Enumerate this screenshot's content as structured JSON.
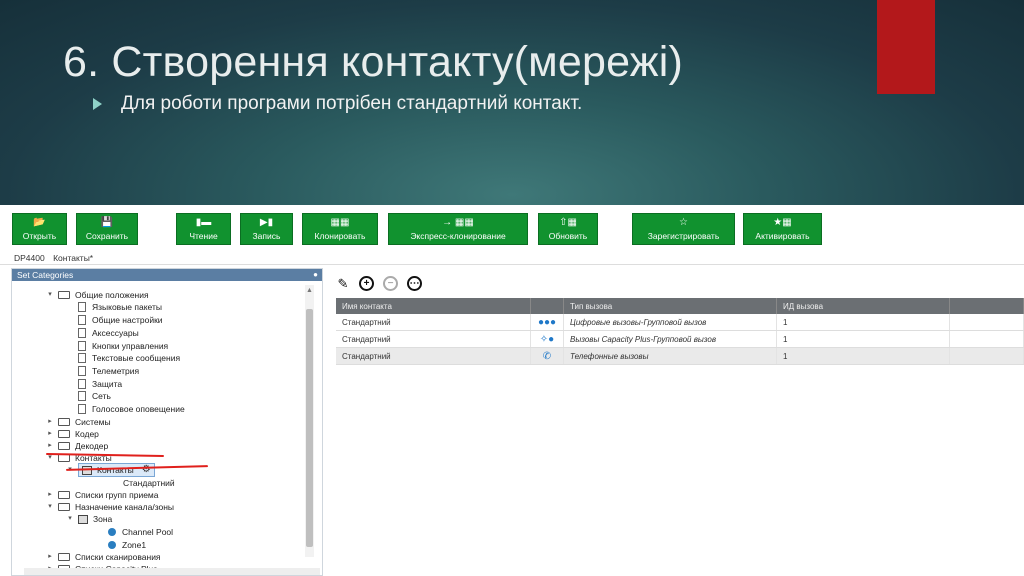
{
  "slide": {
    "title": "6. Створення контакту(мережі)",
    "bullet": "Для роботи програми потрібен стандартний контакт.",
    "accent_color": "#b3181b"
  },
  "toolbar": {
    "buttons": [
      {
        "label": "Открыть",
        "icon": "folder-open-icon"
      },
      {
        "label": "Сохранить",
        "icon": "save-icon"
      },
      {
        "label": "Чтение",
        "icon": "read-icon"
      },
      {
        "label": "Запись",
        "icon": "write-icon"
      },
      {
        "label": "Клонировать",
        "icon": "clone-icon"
      },
      {
        "label": "Экспресс-клонирование",
        "icon": "express-clone-icon"
      },
      {
        "label": "Обновить",
        "icon": "update-icon"
      },
      {
        "label": "Зарегистрировать",
        "icon": "star-icon"
      },
      {
        "label": "Активировать",
        "icon": "activate-icon"
      }
    ]
  },
  "breadcrumb": {
    "items": [
      "DP4400",
      "Контакты*"
    ]
  },
  "categories": {
    "header": "Set Categories",
    "tree": [
      "Общие положения",
      "Языковые пакеты",
      "Общие настройки",
      "Аксессуары",
      "Кнопки управления",
      "Текстовые сообщения",
      "Телеметрия",
      "Защита",
      "Сеть",
      "Голосовое оповещение",
      "Системы",
      "Кодер",
      "Декодер",
      "Контакты",
      "Контакты",
      "Стандартний",
      "Списки групп приема",
      "Назначение канала/зоны",
      "Зона",
      "Channel Pool",
      "Zone1",
      "Списки сканирования",
      "Списки Capacity Plus"
    ]
  },
  "contacts_grid": {
    "columns": [
      "Имя контакта",
      "",
      "Тип вызова",
      "ИД вызова"
    ],
    "rows": [
      {
        "name": "Стандартний",
        "icon": "digital-group-icon",
        "type": "Цифровые вызовы-Групповой вызов",
        "id": "1"
      },
      {
        "name": "Стандартний",
        "icon": "capacity-plus-icon",
        "type": "Вызовы Capacity Plus-Групповой вызов",
        "id": "1"
      },
      {
        "name": "Стандартний",
        "icon": "phone-icon",
        "type": "Телефонные вызовы",
        "id": "1"
      }
    ]
  }
}
